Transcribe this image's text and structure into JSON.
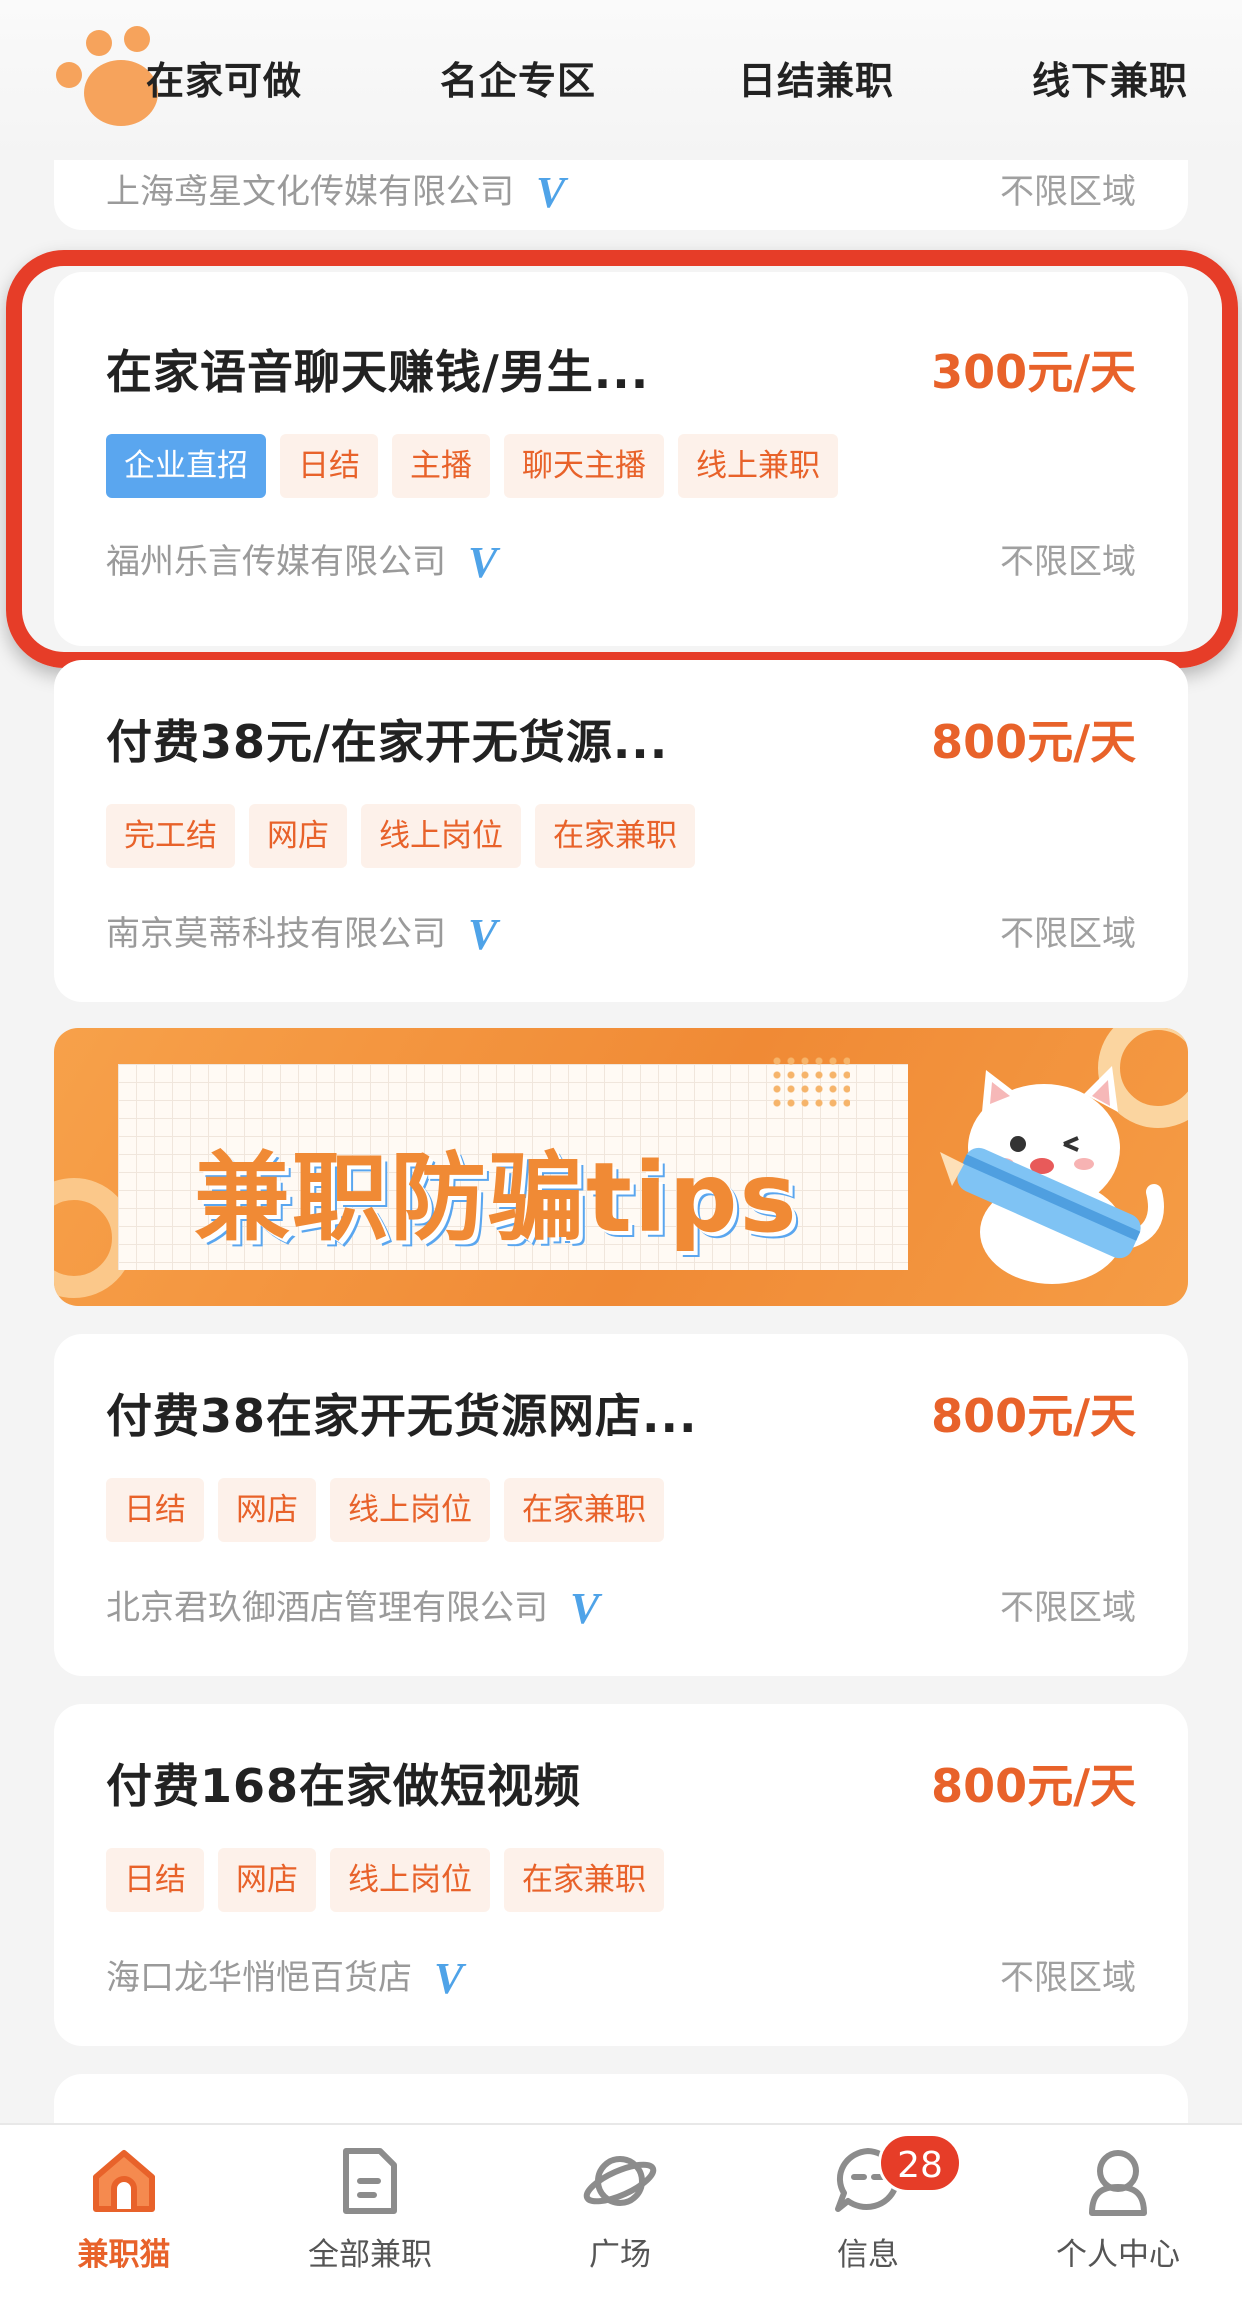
{
  "tabs": [
    "在家可做",
    "名企专区",
    "日结兼职",
    "线下兼职"
  ],
  "partial_card": {
    "company": "上海鸢星文化传媒有限公司",
    "verified_mark": "V",
    "region": "不限区域"
  },
  "jobs": [
    {
      "title": "在家语音聊天赚钱/男生...",
      "salary": "300元/天",
      "tags": [
        "企业直招",
        "日结",
        "主播",
        "聊天主播",
        "线上兼职"
      ],
      "company": "福州乐言传媒有限公司",
      "verified_mark": "V",
      "region": "不限区域"
    },
    {
      "title": "付费38元/在家开无货源...",
      "salary": "800元/天",
      "tags": [
        "完工结",
        "网店",
        "线上岗位",
        "在家兼职"
      ],
      "company": "南京莫蒂科技有限公司",
      "verified_mark": "V",
      "region": "不限区域"
    },
    {
      "title": "付费38在家开无货源网店...",
      "salary": "800元/天",
      "tags": [
        "日结",
        "网店",
        "线上岗位",
        "在家兼职"
      ],
      "company": "北京君玖御酒店管理有限公司",
      "verified_mark": "V",
      "region": "不限区域"
    },
    {
      "title": "付费168在家做短视频",
      "salary": "800元/天",
      "tags": [
        "日结",
        "网店",
        "线上岗位",
        "在家兼职"
      ],
      "company": "海口龙华悄悒百货店",
      "verified_mark": "V",
      "region": "不限区域"
    }
  ],
  "banner": {
    "text": "兼职防骗tips"
  },
  "bottom_nav": [
    {
      "label": "兼职猫",
      "icon": "home-icon",
      "active": true
    },
    {
      "label": "全部兼职",
      "icon": "document-icon",
      "active": false
    },
    {
      "label": "广场",
      "icon": "planet-icon",
      "active": false
    },
    {
      "label": "信息",
      "icon": "message-icon",
      "active": false,
      "badge": "28"
    },
    {
      "label": "个人中心",
      "icon": "user-icon",
      "active": false
    }
  ],
  "colors": {
    "accent": "#e8622a",
    "verified": "#4fa3e8",
    "highlight": "#e63d28",
    "direct_hire_tag": "#5aa6ef"
  }
}
